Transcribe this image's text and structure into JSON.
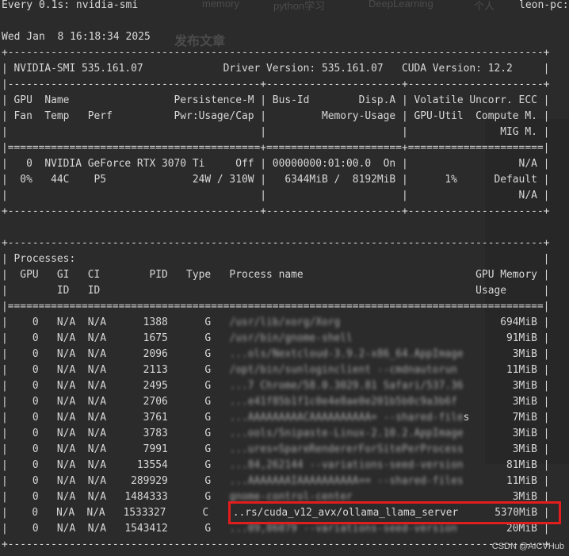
{
  "header": {
    "command": "Every 0.1s: nvidia-smi",
    "host": "leon-pc:",
    "date": "Wed Jan  8 16:18:34 2025"
  },
  "background_ghost": {
    "menu_items": [
      "memory",
      "python学习",
      "DeepLearning",
      "个人"
    ],
    "title": "发布文章"
  },
  "smi_lines": [
    "+---------------------------------------------------------------------------------------+",
    "| NVIDIA-SMI 535.161.07             Driver Version: 535.161.07   CUDA Version: 12.2     |",
    "|-----------------------------------------+----------------------+----------------------+",
    "| GPU  Name                 Persistence-M | Bus-Id        Disp.A | Volatile Uncorr. ECC |",
    "| Fan  Temp   Perf          Pwr:Usage/Cap |         Memory-Usage | GPU-Util  Compute M. |",
    "|                                         |                      |               MIG M. |",
    "|=========================================+======================+======================|",
    "|   0  NVIDIA GeForce RTX 3070 Ti     Off | 00000000:01:00.0  On |                  N/A |",
    "|  0%   44C    P5              24W / 310W |   6344MiB /  8192MiB |      1%      Default |",
    "|                                         |                      |                  N/A |",
    "+-----------------------------------------+----------------------+----------------------+",
    "",
    "+---------------------------------------------------------------------------------------+",
    "| Processes:                                                                            |",
    "|  GPU   GI   CI        PID   Type   Process name                            GPU Memory |",
    "|        ID   ID                                                             Usage      |",
    "|=======================================================================================|",
    "|    0   N/A  N/A      1388      G   /usr/lib/xorg/Xorg                          694MiB |",
    "|    0   N/A  N/A      1675      G   /usr/bin/gnome-shell                         91MiB |",
    "|    0   N/A  N/A      2096      G   ...ols/Nextcloud-3.9.2-x86_64.AppImage        3MiB |",
    "|    0   N/A  N/A      2113      G   /opt/bin/sunloginclient --cmdnautorun        11MiB |",
    "|    0   N/A  N/A      2495      G   ...7 Chrome/58.0.3029.81 Safari/537.36        3MiB |",
    "|    0   N/A  N/A      2706      G   ...e41f85b1f1c0e4e8ae0e201b5b0c9a3b6f         3MiB |",
    "|    0   N/A  N/A      3761      G   ...AAAAAAAAACAAAAAAAAAA= --shared-files       7MiB |",
    "|    0   N/A  N/A      3783      G   ...ools/Snipaste-Linux-2.10.2.AppImage        3MiB |",
    "|    0   N/A  N/A      7991      G   ...ures=SpareRendererForSitePerProcess        3MiB |",
    "|    0   N/A  N/A     13554      G   ...84,262144 --variations-seed-version       81MiB |",
    "|    0   N/A  N/A    289929      G   ...AAAAAAAIAAAAAAAAAA== --shared-files       11MiB |",
    "|    0   N/A  N/A   1484333      G   gnome-control-center                          3MiB |",
    "|    0   N/A  N/A   1533327      C   ...rs/cuda_v12_avx/ollama_llama_server      5370MiB |",
    "|    0   N/A  N/A   1543412      G   ...09,86079 --variations-seed-version        20MiB |",
    "+---------------------------------------------------------------------------------------+"
  ],
  "highlight_color": "#e11d1d",
  "watermark": "CSDN @AICVHub"
}
